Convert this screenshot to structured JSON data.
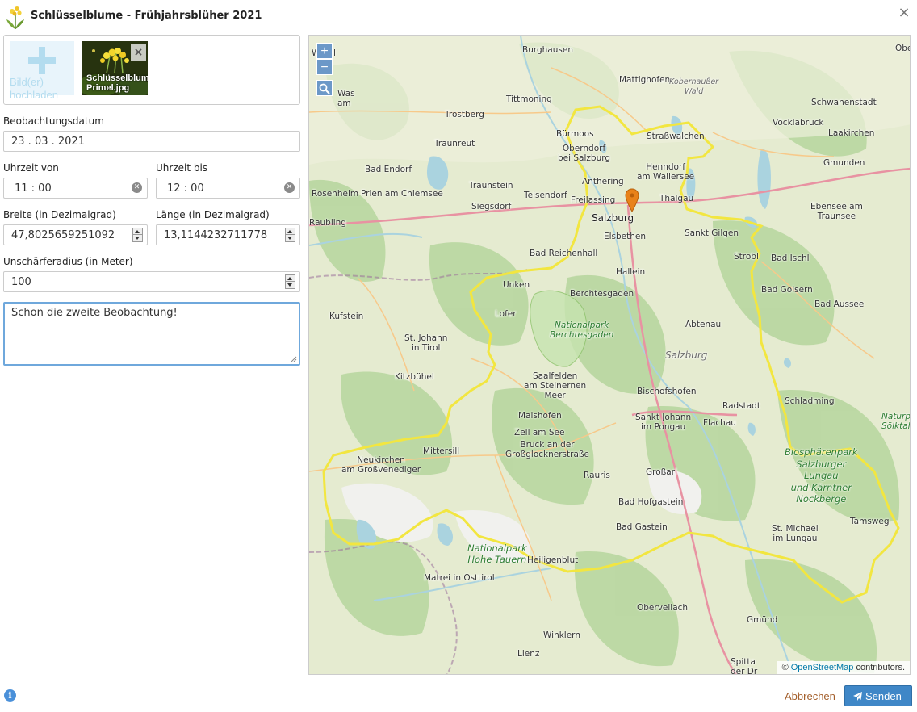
{
  "dialog": {
    "title": "Schlüsselblume - Frühjahrsblüher 2021",
    "close_icon": "×",
    "logo_icon": "primrose-flower-icon"
  },
  "upload": {
    "button_label": "Bild(er)\nhochladen",
    "images": [
      {
        "filename": "Schlüsselblume-\nPrimel.jpg",
        "remove_label": "×"
      }
    ]
  },
  "form": {
    "date_label": "Beobachtungsdatum",
    "date_value": "23 . 03 . 2021",
    "time_from_label": "Uhrzeit von",
    "time_from_value": "11 : 00",
    "time_to_label": "Uhrzeit bis",
    "time_to_value": "12 : 00",
    "lat_label": "Breite (in Dezimalgrad)",
    "lat_value": "47,8025659251092",
    "lon_label": "Länge (in Dezimalgrad)",
    "lon_value": "13,1144232711778",
    "radius_label": "Unschärferadius (in Meter)",
    "radius_value": "100",
    "comment_value": "Schon die zweite Beobachtung!"
  },
  "map": {
    "zoom_in": "+",
    "zoom_out": "−",
    "attribution_prefix": "©",
    "attribution_link": "OpenStreetMap",
    "attribution_suffix": "contributors.",
    "labels": [
      "Burghausen",
      "Mattighofen",
      "Kobernaußer\nWald",
      "Schwanenstadt",
      "Tittmoning",
      "Vöcklabruck",
      "Laakirchen",
      "Trostberg",
      "Bürmoos",
      "Straßwalchen",
      "Oberndorf\nbei Salzburg",
      "Traunreut",
      "Henndorf\nam Wallersee",
      "Gmunden",
      "Bad Endorf",
      "Anthering",
      "Traunstein",
      "Teisendorf",
      "Freilassing",
      "Thalgau",
      "Rosenheim",
      "Prien am Chiemsee",
      "Ebensee am\nTraunsee",
      "Siegsdorf",
      "Salzburg",
      "Elsbethen",
      "Sankt Gilgen",
      "Raubling",
      "Bad Reichenhall",
      "Strobl",
      "Bad Ischl",
      "Hallein",
      "Unken",
      "Berchtesgaden",
      "Bad Goisern",
      "Lofer",
      "Bad Aussee",
      "Kufstein",
      "Nationalpark\nBerchtesgaden",
      "Abtenau",
      "St. Johann\nin Tirol",
      "Salzburg",
      "Saalfelden\nam Steinernen\nMeer",
      "Kitzbühel",
      "Bischofshofen",
      "Radstadt",
      "Schladming",
      "Maishofen",
      "Sankt Johann\nim Pongau",
      "Flachau",
      "Naturpa\nSölktale",
      "Zell am See",
      "Bruck an der\nGroßglocknerstraße",
      "Mittersill",
      "Biosphärenpark\nSalzburger\nLungau\nund Kärntner\nNockberge",
      "Neukirchen\nam Großvenediger",
      "Rauris",
      "Großarl",
      "Bad Hofgastein",
      "Tamsweg",
      "Bad Gastein",
      "St. Michael\nim Lungau",
      "Nationalpark\nHohe Tauern",
      "Heiligenblut",
      "Matrei in Osttirol",
      "Obervellach",
      "Gmünd",
      "Winklern",
      "Lienz",
      "Spitta\nder Dr",
      "Ober",
      "Was\nam",
      "Wörgl"
    ]
  },
  "footer": {
    "info_icon": "i",
    "cancel_label": "Abbrechen",
    "send_label": "Senden"
  },
  "colors": {
    "accent": "#3f87c7",
    "cancel": "#a35e2a",
    "boundary": "#f2e640",
    "marker": "#e8821a"
  }
}
